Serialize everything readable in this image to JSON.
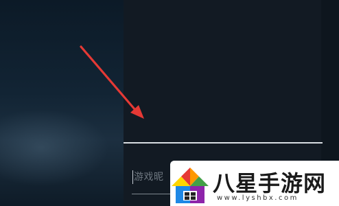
{
  "nickname_field": {
    "placeholder": "游戏昵"
  },
  "watermark": {
    "brand_text": "八星手游网",
    "url_text": "www.lyshbx.com"
  },
  "colors": {
    "background": "#0b1520",
    "panel": "#121a23",
    "separator": "#d8dde2",
    "annotation_arrow": "#e53935"
  },
  "icons": {
    "annotation": "arrow-pointer-icon",
    "watermark_logo": "house-logo-icon"
  }
}
